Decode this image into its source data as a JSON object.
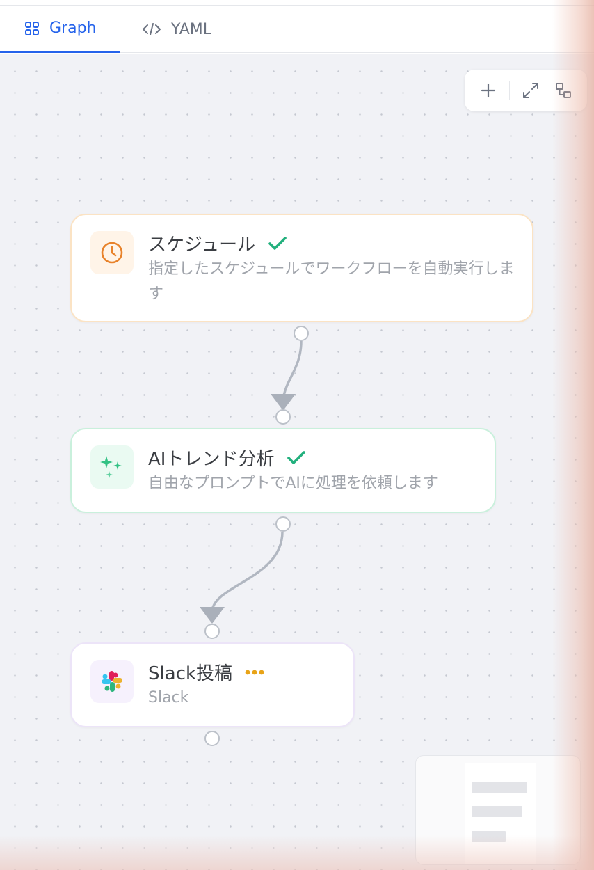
{
  "tabs": [
    {
      "label": "Graph",
      "icon": "grid-icon",
      "active": true
    },
    {
      "label": "YAML",
      "icon": "code-icon",
      "active": false
    }
  ],
  "controls": [
    "zoom-in-icon",
    "fit-view-icon",
    "layout-icon"
  ],
  "nodes": [
    {
      "title": "スケジュール",
      "description": "指定したスケジュールでワークフローを自動実行します",
      "icon": "clock-icon",
      "status": "success",
      "accent": "#e8822a"
    },
    {
      "title": "AIトレンド分析",
      "description": "自由なプロンプトでAIに処理を依頼します",
      "icon": "sparkles-icon",
      "status": "success",
      "accent": "#2fbf82"
    },
    {
      "title": "Slack投稿",
      "description": "Slack",
      "icon": "slack-icon",
      "status": "running",
      "accent": "#e8a317"
    }
  ],
  "colors": {
    "active_tab": "#2563eb",
    "success_check": "#22b07d",
    "edge": "#b1b7c1"
  }
}
